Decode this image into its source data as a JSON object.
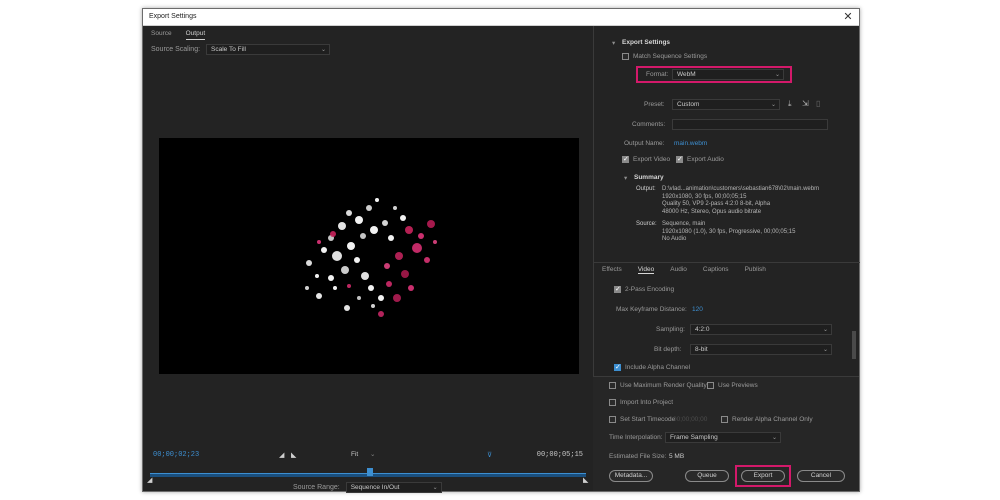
{
  "window": {
    "title": "Export Settings"
  },
  "left": {
    "tabs": [
      {
        "label": "Source"
      },
      {
        "label": "Output"
      }
    ],
    "source_scaling_label": "Source Scaling:",
    "source_scaling_value": "Scale To Fill",
    "timecode_in": "00;00;02;23",
    "timecode_out": "00;00;05;15",
    "fit_value": "Fit",
    "source_range_label": "Source Range:",
    "source_range_value": "Sequence In/Out"
  },
  "export_settings": {
    "heading": "Export Settings",
    "match_sequence_label": "Match Sequence Settings",
    "format_label": "Format:",
    "format_value": "WebM",
    "preset_label": "Preset:",
    "preset_value": "Custom",
    "comments_label": "Comments:",
    "output_name_label": "Output Name:",
    "output_name_value": "main.webm",
    "export_video_label": "Export Video",
    "export_audio_label": "Export Audio",
    "summary_heading": "Summary",
    "output_label": "Output:",
    "output_lines": [
      "D:\\vlad...animation\\customers\\sebastian678\\02\\main.webm",
      "1920x1080, 30 fps, 00;00;05;15",
      "Quality 50, VP9 2-pass 4:2:0 8-bit, Alpha",
      "48000 Hz, Stereo, Opus audio bitrate"
    ],
    "source_label": "Source:",
    "source_lines": [
      "Sequence, main",
      "1920x1080 (1.0), 30 fps, Progressive, 00;00;05;15",
      "No Audio"
    ]
  },
  "tabs": [
    {
      "label": "Effects"
    },
    {
      "label": "Video"
    },
    {
      "label": "Audio"
    },
    {
      "label": "Captions"
    },
    {
      "label": "Publish"
    }
  ],
  "video": {
    "two_pass_label": "2-Pass Encoding",
    "max_keyframe_label": "Max Keyframe Distance:",
    "max_keyframe_value": "120",
    "sampling_label": "Sampling:",
    "sampling_value": "4:2:0",
    "bit_depth_label": "Bit depth:",
    "bit_depth_value": "8-bit",
    "alpha_label": "Include Alpha Channel"
  },
  "bottom": {
    "max_render_label": "Use Maximum Render Quality",
    "use_previews_label": "Use Previews",
    "import_label": "Import Into Project",
    "set_start_label": "Set Start Timecode",
    "start_timecode_value": "00;00;00;00",
    "render_alpha_label": "Render Alpha Channel Only",
    "time_interp_label": "Time Interpolation:",
    "time_interp_value": "Frame Sampling",
    "est_size_label": "Estimated File Size:",
    "est_size_value": "5 MB",
    "metadata_label": "Metadata...",
    "queue_label": "Queue",
    "export_label": "Export",
    "cancel_label": "Cancel"
  },
  "colors": {
    "accent": "#3d8fd1",
    "highlight": "#d3196a",
    "background": "#232323"
  }
}
